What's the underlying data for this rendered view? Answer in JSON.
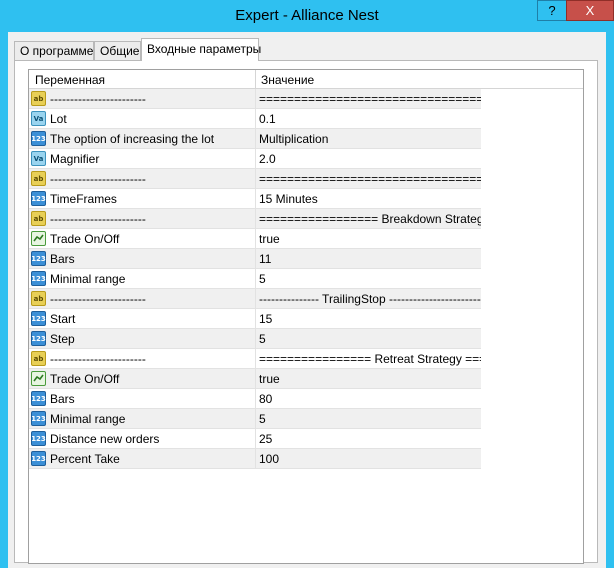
{
  "window": {
    "title": "Expert - Alliance Nest",
    "help_label": "?",
    "close_label": "X"
  },
  "tabs": [
    {
      "label": "О программе"
    },
    {
      "label": "Общие"
    },
    {
      "label": "Входные параметры"
    }
  ],
  "grid": {
    "col_variable": "Переменная",
    "col_value": "Значение",
    "rows": [
      {
        "type": "ab",
        "icon": "string-icon",
        "name": "------------------------",
        "value": "====================================..."
      },
      {
        "type": "va",
        "icon": "double-icon",
        "name": "Lot",
        "value": "0.1"
      },
      {
        "type": "num",
        "icon": "integer-icon",
        "name": "The option of increasing the lot",
        "value": "Multiplication"
      },
      {
        "type": "va",
        "icon": "double-icon",
        "name": "Magnifier",
        "value": "2.0"
      },
      {
        "type": "ab",
        "icon": "string-icon",
        "name": "------------------------",
        "value": "====================================..."
      },
      {
        "type": "num",
        "icon": "integer-icon",
        "name": "TimeFrames",
        "value": "15 Minutes"
      },
      {
        "type": "ab",
        "icon": "string-icon",
        "name": "------------------------",
        "value": "================= Breakdown Strategy ===..."
      },
      {
        "type": "bool",
        "icon": "boolean-icon",
        "name": "Trade On/Off",
        "value": "true"
      },
      {
        "type": "num",
        "icon": "integer-icon",
        "name": "Bars",
        "value": "11"
      },
      {
        "type": "num",
        "icon": "integer-icon",
        "name": "Minimal range",
        "value": "5"
      },
      {
        "type": "ab",
        "icon": "string-icon",
        "name": "------------------------",
        "value": "---------------  TrailingStop  ------------------------"
      },
      {
        "type": "num",
        "icon": "integer-icon",
        "name": "Start",
        "value": "15"
      },
      {
        "type": "num",
        "icon": "integer-icon",
        "name": "Step",
        "value": "5"
      },
      {
        "type": "ab",
        "icon": "string-icon",
        "name": "------------------------",
        "value": "================ Retreat Strategy ====..."
      },
      {
        "type": "bool",
        "icon": "boolean-icon",
        "name": "Trade On/Off",
        "value": "true"
      },
      {
        "type": "num",
        "icon": "integer-icon",
        "name": "Bars",
        "value": "80"
      },
      {
        "type": "num",
        "icon": "integer-icon",
        "name": "Minimal range",
        "value": "5"
      },
      {
        "type": "num",
        "icon": "integer-icon",
        "name": "Distance new orders",
        "value": "25"
      },
      {
        "type": "num",
        "icon": "integer-icon",
        "name": "Percent Take",
        "value": "100"
      }
    ]
  },
  "colors": {
    "titlebar": "#2fc0f0",
    "close_button": "#c7504a",
    "row_alt": "#f0f0f0"
  }
}
